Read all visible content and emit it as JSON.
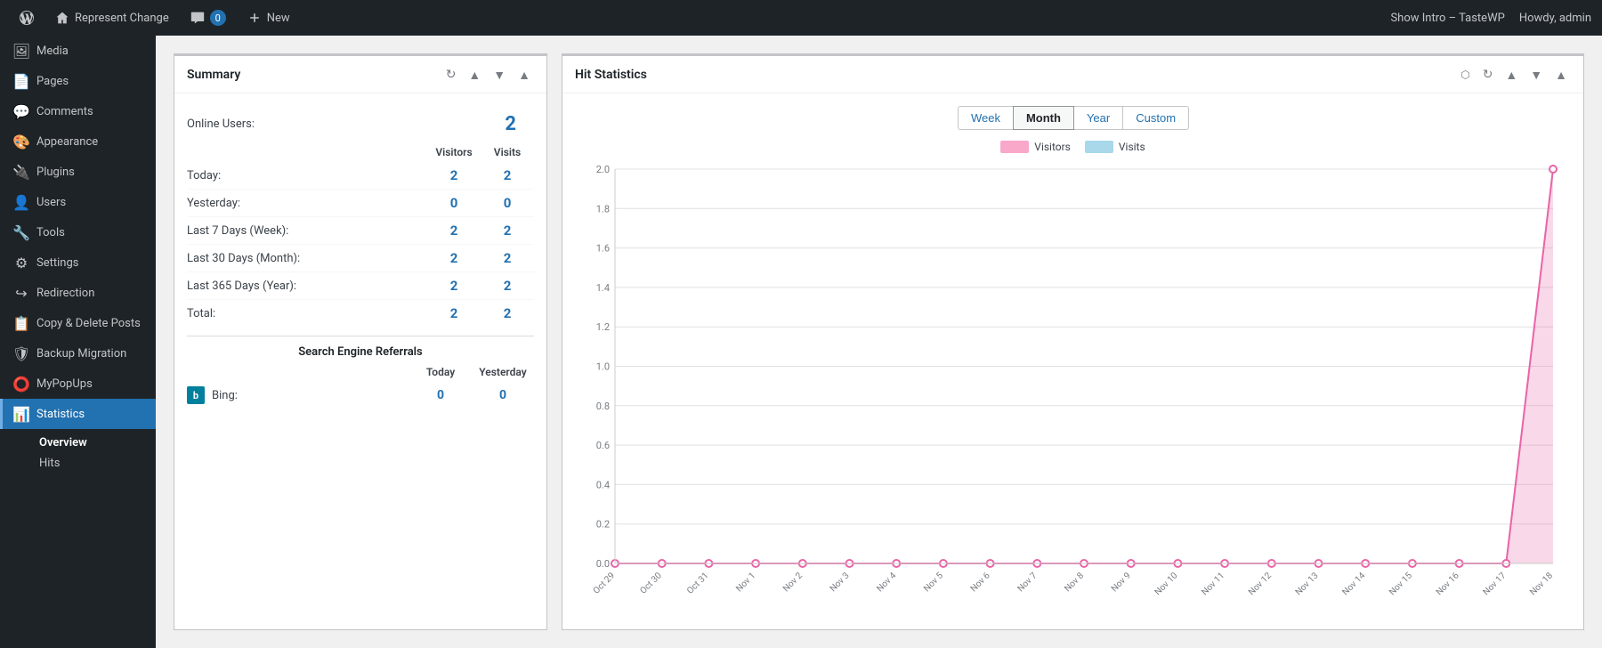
{
  "adminbar": {
    "site_name": "Represent Change",
    "comments_count": "0",
    "new_label": "New",
    "show_intro": "Show Intro – TasteWP",
    "howdy": "Howdy, admin"
  },
  "sidebar": {
    "items": [
      {
        "id": "media",
        "label": "Media",
        "icon": "media"
      },
      {
        "id": "pages",
        "label": "Pages",
        "icon": "pages"
      },
      {
        "id": "comments",
        "label": "Comments",
        "icon": "comments"
      },
      {
        "id": "appearance",
        "label": "Appearance",
        "icon": "appearance"
      },
      {
        "id": "plugins",
        "label": "Plugins",
        "icon": "plugins"
      },
      {
        "id": "users",
        "label": "Users",
        "icon": "users"
      },
      {
        "id": "tools",
        "label": "Tools",
        "icon": "tools"
      },
      {
        "id": "settings",
        "label": "Settings",
        "icon": "settings"
      },
      {
        "id": "redirection",
        "label": "Redirection",
        "icon": "redirection"
      },
      {
        "id": "copy-delete",
        "label": "Copy & Delete Posts",
        "icon": "copy"
      },
      {
        "id": "backup-migration",
        "label": "Backup Migration",
        "icon": "backup"
      },
      {
        "id": "mypopups",
        "label": "MyPopUps",
        "icon": "popups"
      },
      {
        "id": "statistics",
        "label": "Statistics",
        "icon": "statistics",
        "active": true
      }
    ],
    "sub_items": [
      {
        "id": "overview",
        "label": "Overview",
        "active": true
      },
      {
        "id": "hits",
        "label": "Hits"
      }
    ]
  },
  "summary_widget": {
    "title": "Summary",
    "online_users_label": "Online Users:",
    "online_users_value": "2",
    "col_visitors": "Visitors",
    "col_visits": "Visits",
    "rows": [
      {
        "label": "Today:",
        "visitors": "2",
        "visits": "2"
      },
      {
        "label": "Yesterday:",
        "visitors": "0",
        "visits": "0"
      },
      {
        "label": "Last 7 Days (Week):",
        "visitors": "2",
        "visits": "2"
      },
      {
        "label": "Last 30 Days (Month):",
        "visitors": "2",
        "visits": "2"
      },
      {
        "label": "Last 365 Days (Year):",
        "visitors": "2",
        "visits": "2"
      },
      {
        "label": "Total:",
        "visitors": "2",
        "visits": "2"
      }
    ],
    "referrals_title": "Search Engine Referrals",
    "ref_col_today": "Today",
    "ref_col_yesterday": "Yesterday",
    "referrals": [
      {
        "name": "Bing:",
        "today": "0",
        "yesterday": "0"
      }
    ]
  },
  "hit_statistics": {
    "title": "Hit Statistics",
    "tabs": [
      "Week",
      "Month",
      "Year",
      "Custom"
    ],
    "active_tab": "Month",
    "legend_visitors": "Visitors",
    "legend_visits": "Visits",
    "legend_visitors_color": "#f9a8c9",
    "legend_visits_color": "#a8d8ea",
    "y_labels": [
      "2.0",
      "1.8",
      "1.6",
      "1.4",
      "1.2",
      "1.0",
      "0.8",
      "0.6",
      "0.4",
      "0.2",
      "0"
    ],
    "x_labels": [
      "Oct 29",
      "Oct 30",
      "Oct 31",
      "Nov 1",
      "Nov 2",
      "Nov 3",
      "Nov 4",
      "Nov 5",
      "Nov 6",
      "Nov 7",
      "Nov 8",
      "Nov 9",
      "Nov 10",
      "Nov 11",
      "Nov 12",
      "Nov 13",
      "Nov 14",
      "Nov 15",
      "Nov 16",
      "Nov 17",
      "Nov 18"
    ],
    "data_points": [
      0,
      0,
      0,
      0,
      0,
      0,
      0,
      0,
      0,
      0,
      0,
      0,
      0,
      0,
      0,
      0,
      0,
      0,
      0,
      0,
      2
    ]
  }
}
